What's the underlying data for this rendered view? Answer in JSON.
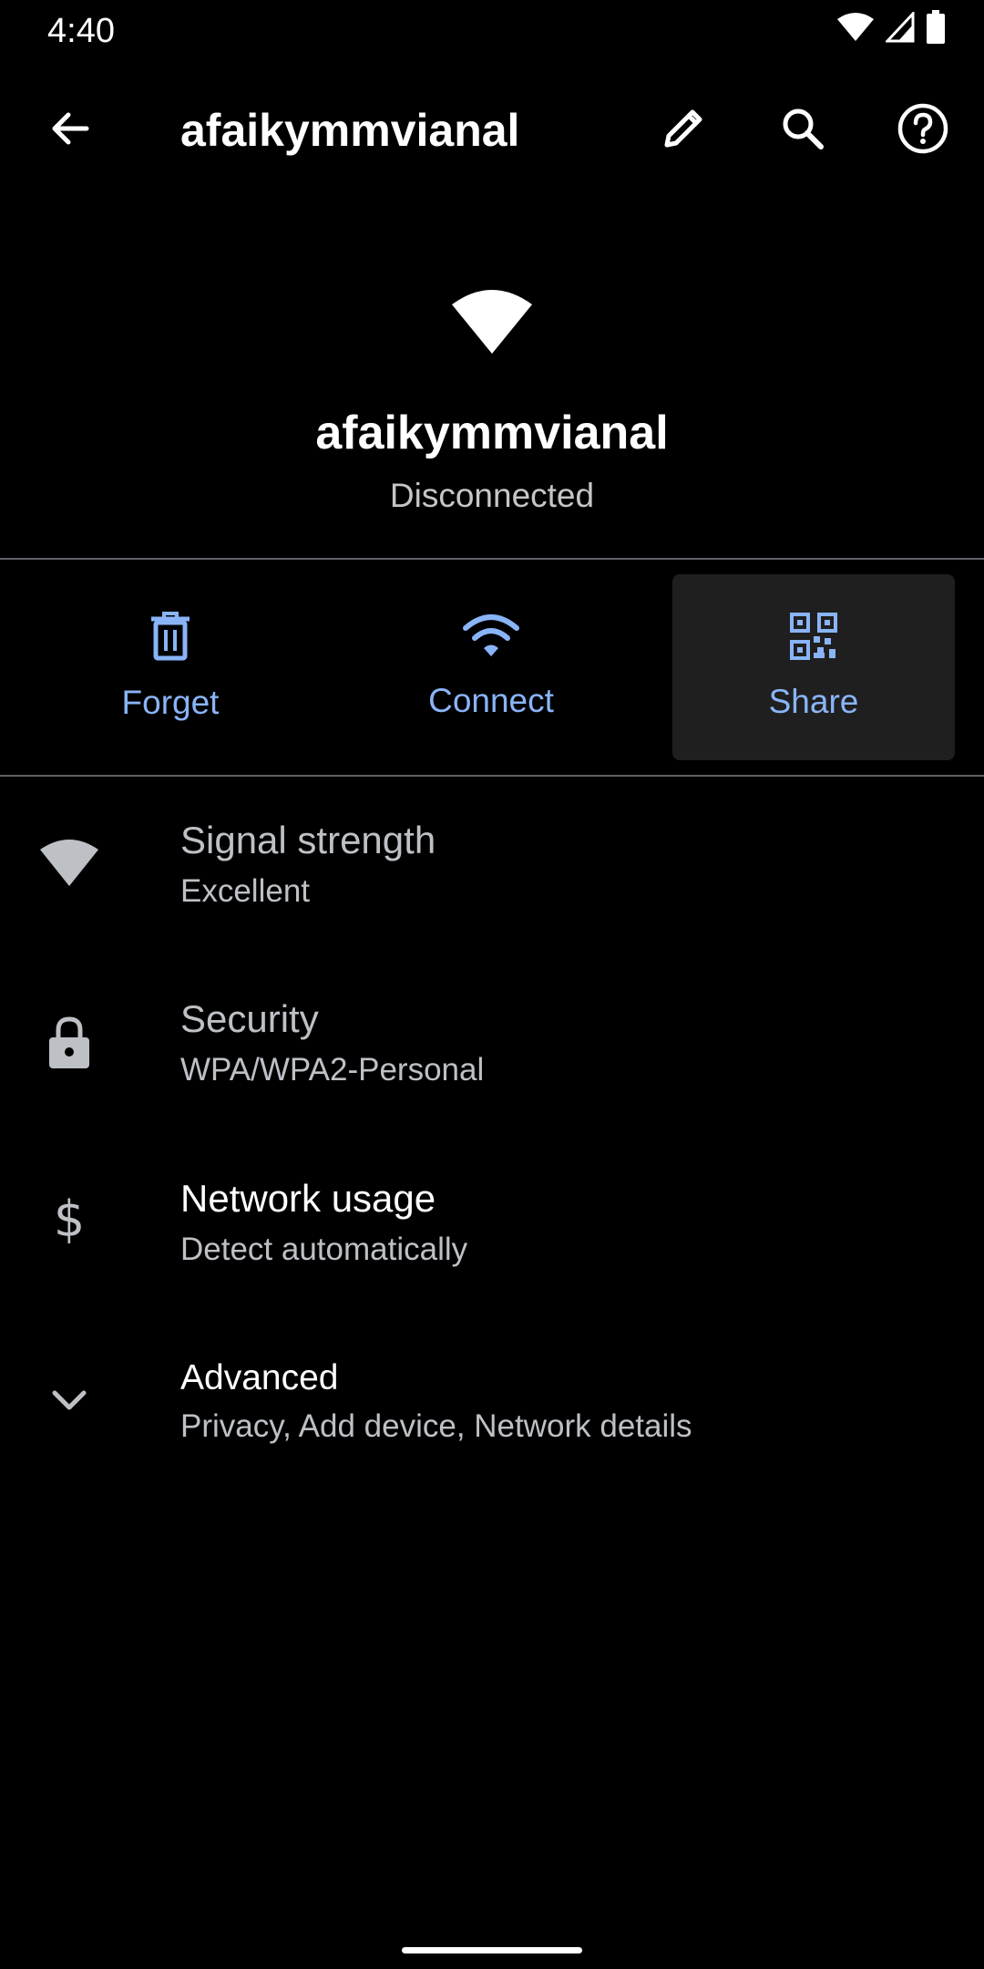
{
  "status_bar": {
    "time": "4:40",
    "icons": [
      "wifi-icon",
      "cellular-icon",
      "battery-icon"
    ]
  },
  "app_bar": {
    "title": "afaikymmvianal",
    "actions": [
      "back-arrow-icon",
      "edit-pencil-icon",
      "search-icon",
      "help-icon"
    ]
  },
  "header": {
    "icon": "wifi-icon",
    "network_name": "afaikymmvianal",
    "status": "Disconnected"
  },
  "actions": [
    {
      "label": "Forget",
      "icon": "trash-icon"
    },
    {
      "label": "Connect",
      "icon": "wifi-icon"
    },
    {
      "label": "Share",
      "icon": "qr-code-icon"
    }
  ],
  "preferences": [
    {
      "title": "Signal strength",
      "summary": "Excellent",
      "icon": "wifi-signal-icon"
    },
    {
      "title": "Security",
      "summary": "WPA/WPA2-Personal",
      "icon": "lock-icon"
    },
    {
      "title": "Network usage",
      "summary": "Detect automatically",
      "icon": "dollar-icon"
    },
    {
      "title": "Advanced",
      "summary": "Privacy, Add device, Network details",
      "icon": "chevron-down-icon"
    }
  ],
  "colors": {
    "background": "#000000",
    "accent": "#8ab4f8",
    "highlight": "#1f1f1f",
    "divider": "#5f6368",
    "secondary_text": "#bdc1c6"
  }
}
